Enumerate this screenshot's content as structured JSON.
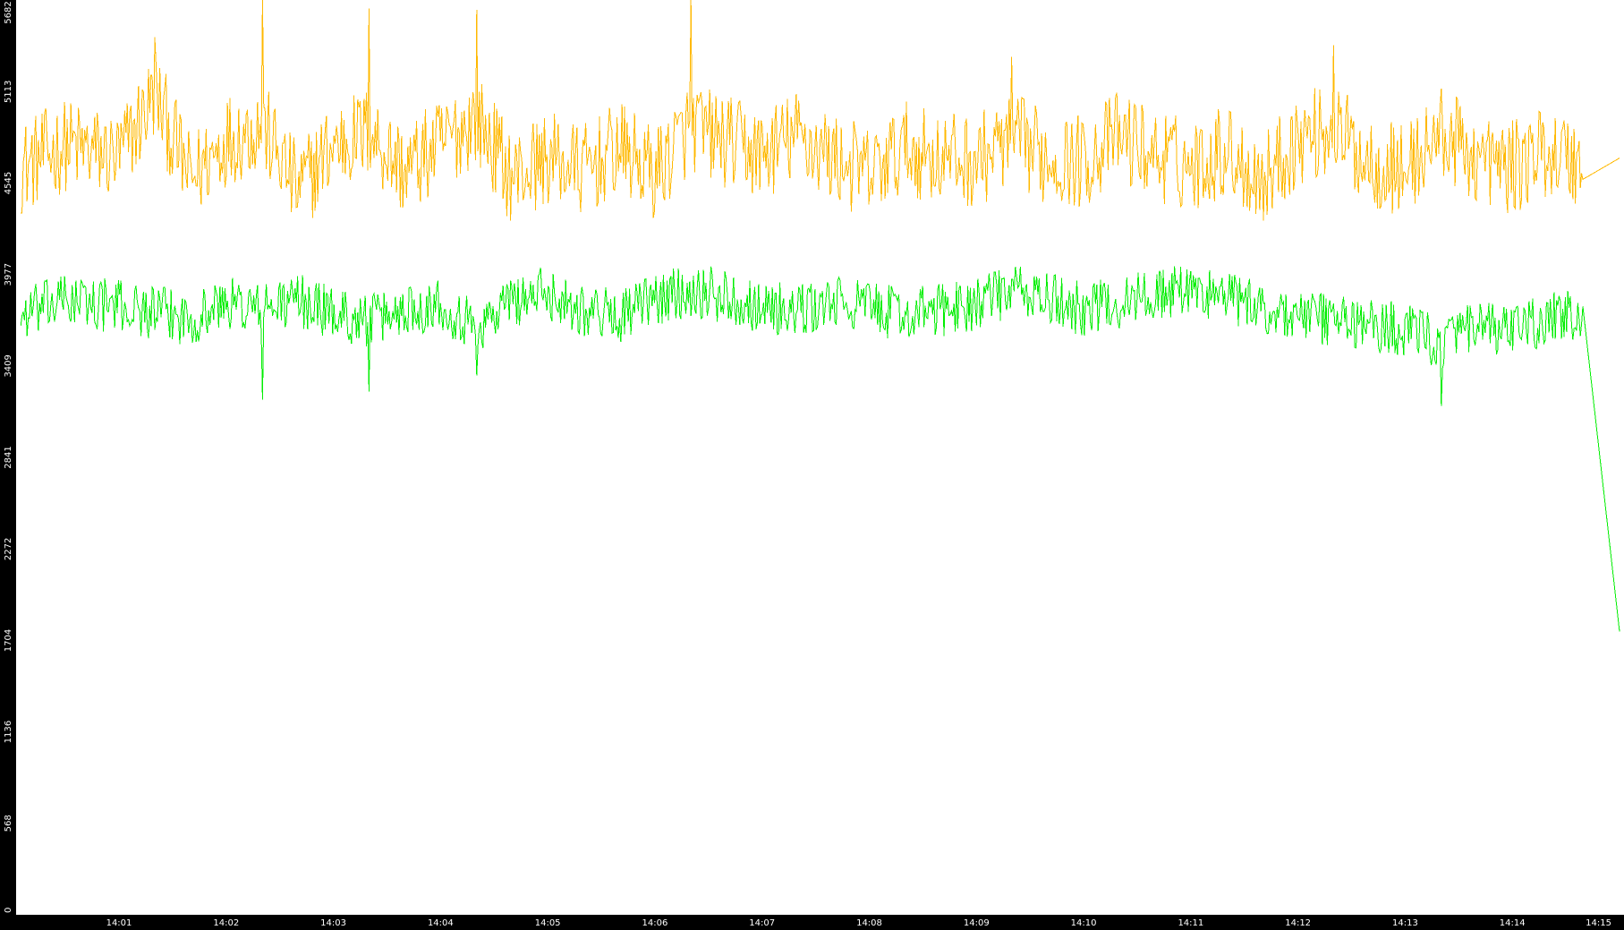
{
  "chart_data": {
    "type": "line",
    "title": "",
    "xlabel": "",
    "ylabel": "",
    "ylim": [
      0,
      5682
    ],
    "y_ticks": [
      "0",
      "568",
      "1136",
      "1704",
      "2272",
      "2841",
      "3409",
      "3977",
      "4545",
      "5113",
      "5682"
    ],
    "x_ticks": [
      "14:01",
      "14:02",
      "14:03",
      "14:04",
      "14:05",
      "14:06",
      "14:07",
      "14:08",
      "14:09",
      "14:10",
      "14:11",
      "14:12",
      "14:13",
      "14:14",
      "14:15"
    ],
    "x_range": [
      "14:00:05",
      "14:15:00"
    ],
    "grid": false,
    "legend": "none",
    "colors": {
      "background": "#ffffff",
      "axis_panel": "#000000",
      "tick_text": "#ffffff"
    },
    "series": [
      {
        "color": "#ffb800",
        "approx_mean": 4730,
        "approx_range": [
          4050,
          5682
        ],
        "points": [
          [
            "14:00:05",
            4640
          ],
          [
            "14:00:30",
            4780
          ],
          [
            "14:01:00",
            4700
          ],
          [
            "14:01:20",
            5100
          ],
          [
            "14:01:40",
            4560
          ],
          [
            "14:02:00",
            4820
          ],
          [
            "14:02:20",
            4900
          ],
          [
            "14:02:40",
            4500
          ],
          [
            "14:03:00",
            4780
          ],
          [
            "14:03:20",
            4860
          ],
          [
            "14:03:40",
            4620
          ],
          [
            "14:04:00",
            4780
          ],
          [
            "14:04:20",
            4950
          ],
          [
            "14:04:40",
            4580
          ],
          [
            "14:05:00",
            4700
          ],
          [
            "14:05:20",
            4620
          ],
          [
            "14:05:40",
            4760
          ],
          [
            "14:06:00",
            4600
          ],
          [
            "14:06:20",
            4900
          ],
          [
            "14:06:40",
            4800
          ],
          [
            "14:07:00",
            4720
          ],
          [
            "14:07:20",
            4840
          ],
          [
            "14:07:40",
            4700
          ],
          [
            "14:08:00",
            4600
          ],
          [
            "14:08:20",
            4760
          ],
          [
            "14:08:40",
            4700
          ],
          [
            "14:09:00",
            4680
          ],
          [
            "14:09:20",
            4820
          ],
          [
            "14:09:40",
            4700
          ],
          [
            "14:10:00",
            4680
          ],
          [
            "14:10:20",
            4840
          ],
          [
            "14:10:40",
            4720
          ],
          [
            "14:11:00",
            4650
          ],
          [
            "14:11:20",
            4760
          ],
          [
            "14:11:40",
            4560
          ],
          [
            "14:12:00",
            4820
          ],
          [
            "14:12:20",
            4880
          ],
          [
            "14:12:40",
            4680
          ],
          [
            "14:13:00",
            4620
          ],
          [
            "14:13:20",
            4860
          ],
          [
            "14:13:40",
            4700
          ],
          [
            "14:14:00",
            4640
          ],
          [
            "14:14:20",
            4760
          ],
          [
            "14:14:40",
            4650
          ],
          [
            "14:15:00",
            4700
          ]
        ],
        "spikes": [
          [
            "14:01:20",
            5450
          ],
          [
            "14:02:20",
            5682
          ],
          [
            "14:03:20",
            5630
          ],
          [
            "14:04:20",
            5620
          ],
          [
            "14:06:20",
            5682
          ],
          [
            "14:09:20",
            5330
          ],
          [
            "14:12:20",
            5400
          ],
          [
            "14:14:20",
            4620
          ]
        ]
      },
      {
        "color": "#00ee00",
        "approx_mean": 3770,
        "approx_range": [
          3160,
          4100
        ],
        "points": [
          [
            "14:00:05",
            3720
          ],
          [
            "14:00:30",
            3820
          ],
          [
            "14:01:00",
            3780
          ],
          [
            "14:01:20",
            3740
          ],
          [
            "14:01:40",
            3700
          ],
          [
            "14:02:00",
            3800
          ],
          [
            "14:02:20",
            3760
          ],
          [
            "14:02:40",
            3820
          ],
          [
            "14:03:00",
            3740
          ],
          [
            "14:03:20",
            3680
          ],
          [
            "14:03:40",
            3760
          ],
          [
            "14:04:00",
            3800
          ],
          [
            "14:04:20",
            3640
          ],
          [
            "14:04:40",
            3820
          ],
          [
            "14:05:00",
            3860
          ],
          [
            "14:05:20",
            3760
          ],
          [
            "14:05:40",
            3720
          ],
          [
            "14:06:00",
            3820
          ],
          [
            "14:06:20",
            3880
          ],
          [
            "14:06:40",
            3840
          ],
          [
            "14:07:00",
            3780
          ],
          [
            "14:07:20",
            3740
          ],
          [
            "14:07:40",
            3800
          ],
          [
            "14:08:00",
            3780
          ],
          [
            "14:08:20",
            3720
          ],
          [
            "14:08:40",
            3760
          ],
          [
            "14:09:00",
            3800
          ],
          [
            "14:09:20",
            3880
          ],
          [
            "14:09:40",
            3820
          ],
          [
            "14:10:00",
            3760
          ],
          [
            "14:10:20",
            3800
          ],
          [
            "14:10:40",
            3860
          ],
          [
            "14:11:00",
            3880
          ],
          [
            "14:11:20",
            3840
          ],
          [
            "14:11:40",
            3760
          ],
          [
            "14:12:00",
            3720
          ],
          [
            "14:12:20",
            3700
          ],
          [
            "14:12:40",
            3660
          ],
          [
            "14:13:00",
            3640
          ],
          [
            "14:13:20",
            3560
          ],
          [
            "14:13:40",
            3640
          ],
          [
            "14:14:00",
            3620
          ],
          [
            "14:14:20",
            3700
          ],
          [
            "14:14:40",
            3720
          ],
          [
            "14:15:00",
            1760
          ]
        ],
        "spikes": [
          [
            "14:02:20",
            3200
          ],
          [
            "14:03:20",
            3250
          ],
          [
            "14:04:20",
            3350
          ],
          [
            "14:13:20",
            3160
          ]
        ]
      }
    ]
  }
}
